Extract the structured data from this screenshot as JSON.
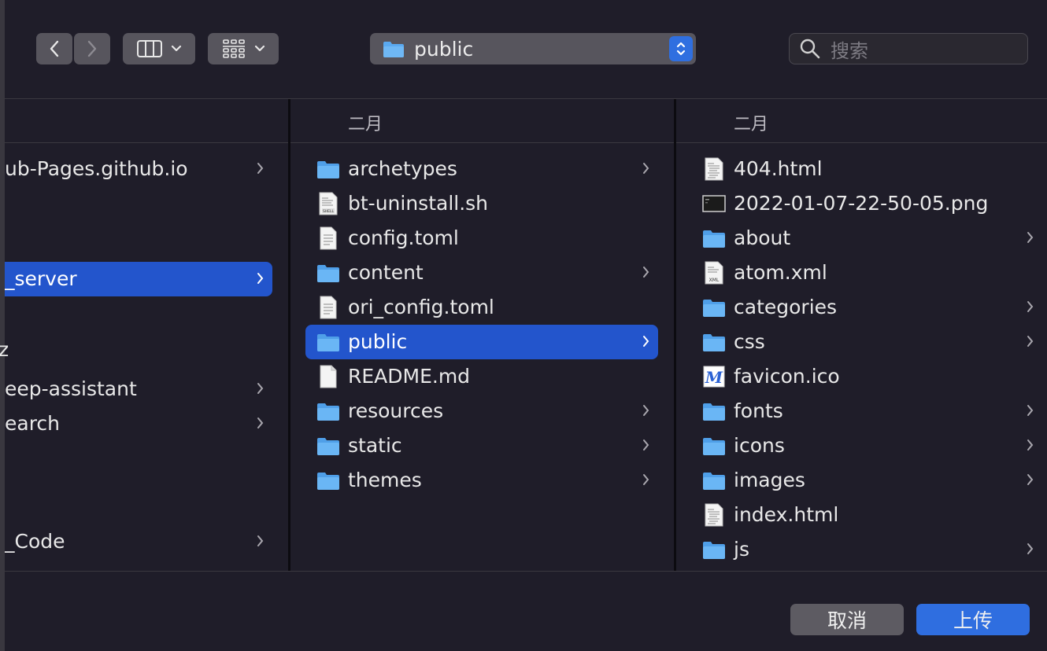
{
  "toolbar": {
    "path_label": "public",
    "search_placeholder": "搜索"
  },
  "columns": {
    "c2_header": "二月",
    "c3_header": "二月"
  },
  "column1": [
    {
      "name": "ub-Pages.github.io",
      "has_children": true,
      "selected": false
    },
    {
      "name": "_server",
      "has_children": true,
      "selected": true
    },
    {
      "name": "z",
      "has_children": false,
      "selected": false
    },
    {
      "name": "eep-assistant",
      "has_children": true,
      "selected": false
    },
    {
      "name": "earch",
      "has_children": true,
      "selected": false
    },
    {
      "name": "_Code",
      "has_children": true,
      "selected": false
    }
  ],
  "column2": [
    {
      "name": "archetypes",
      "icon": "folder-icon",
      "has_children": true
    },
    {
      "name": "bt-uninstall.sh",
      "icon": "shell-file-icon",
      "has_children": false
    },
    {
      "name": "config.toml",
      "icon": "text-file-icon",
      "has_children": false
    },
    {
      "name": "content",
      "icon": "folder-icon",
      "has_children": true
    },
    {
      "name": "ori_config.toml",
      "icon": "text-file-icon",
      "has_children": false
    },
    {
      "name": "public",
      "icon": "folder-icon",
      "has_children": true,
      "selected": true
    },
    {
      "name": "README.md",
      "icon": "blank-file-icon",
      "has_children": false
    },
    {
      "name": "resources",
      "icon": "folder-icon",
      "has_children": true
    },
    {
      "name": "static",
      "icon": "folder-icon",
      "has_children": true
    },
    {
      "name": "themes",
      "icon": "folder-icon",
      "has_children": true
    }
  ],
  "column3": [
    {
      "name": "404.html",
      "icon": "html-file-icon",
      "has_children": false
    },
    {
      "name": "2022-01-07-22-50-05.png",
      "icon": "image-file-icon",
      "has_children": false
    },
    {
      "name": "about",
      "icon": "folder-icon",
      "has_children": true
    },
    {
      "name": "atom.xml",
      "icon": "xml-file-icon",
      "has_children": false
    },
    {
      "name": "categories",
      "icon": "folder-icon",
      "has_children": true
    },
    {
      "name": "css",
      "icon": "folder-icon",
      "has_children": true
    },
    {
      "name": "favicon.ico",
      "icon": "favicon-file-icon",
      "has_children": false
    },
    {
      "name": "fonts",
      "icon": "folder-icon",
      "has_children": true
    },
    {
      "name": "icons",
      "icon": "folder-icon",
      "has_children": true
    },
    {
      "name": "images",
      "icon": "folder-icon",
      "has_children": true
    },
    {
      "name": "index.html",
      "icon": "html-file-icon",
      "has_children": false
    },
    {
      "name": "js",
      "icon": "folder-icon",
      "has_children": true
    }
  ],
  "buttons": {
    "cancel": "取消",
    "upload": "上传"
  },
  "colors": {
    "selection": "#2355cc",
    "accent": "#2f6ee0",
    "folder": "#5aa9f0"
  }
}
